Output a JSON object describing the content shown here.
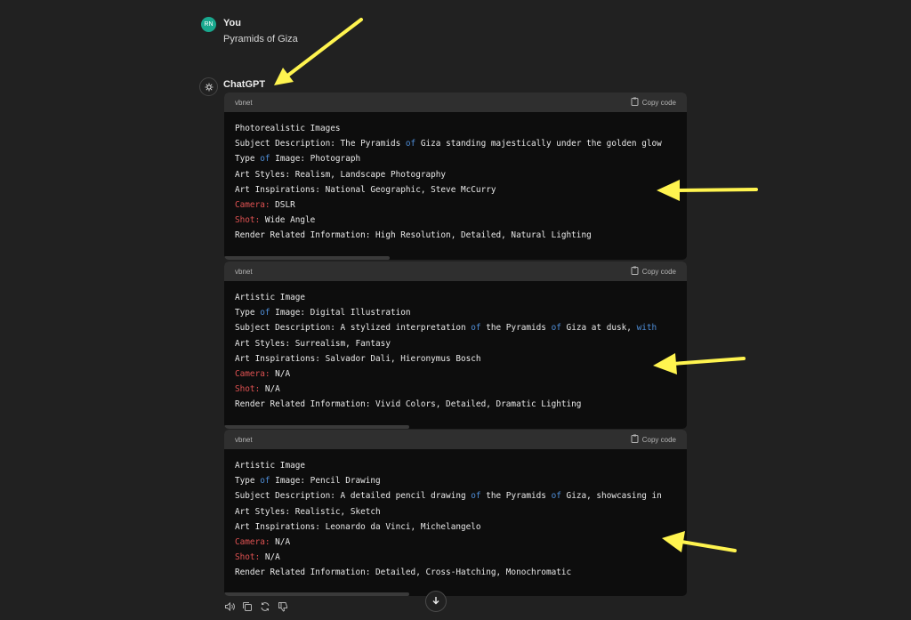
{
  "user": {
    "avatar_text": "RN",
    "name": "You",
    "message": "Pyramids of Giza"
  },
  "assistant": {
    "name": "ChatGPT"
  },
  "copy_label": "Copy code",
  "code_blocks": [
    {
      "lang": "vbnet",
      "lines": [
        [
          {
            "t": "Photorealistic Images"
          }
        ],
        [
          {
            "t": "Subject Description: The Pyramids "
          },
          {
            "t": "of",
            "c": "kw"
          },
          {
            "t": " Giza standing majestically under the golden glow"
          }
        ],
        [
          {
            "t": "Type "
          },
          {
            "t": "of",
            "c": "kw"
          },
          {
            "t": " Image: Photograph"
          }
        ],
        [
          {
            "t": "Art Styles: Realism, Landscape Photography"
          }
        ],
        [
          {
            "t": "Art Inspirations: National Geographic, Steve McCurry"
          }
        ],
        [
          {
            "t": "Camera:",
            "c": "red"
          },
          {
            "t": " DSLR"
          }
        ],
        [
          {
            "t": "Shot:",
            "c": "red"
          },
          {
            "t": " Wide Angle"
          }
        ],
        [
          {
            "t": "Render Related Information: High Resolution, Detailed, Natural Lighting"
          }
        ]
      ]
    },
    {
      "lang": "vbnet",
      "lines": [
        [
          {
            "t": "Artistic Image"
          }
        ],
        [
          {
            "t": "Type "
          },
          {
            "t": "of",
            "c": "kw"
          },
          {
            "t": " Image: Digital Illustration"
          }
        ],
        [
          {
            "t": "Subject Description: A stylized interpretation "
          },
          {
            "t": "of",
            "c": "kw"
          },
          {
            "t": " the Pyramids "
          },
          {
            "t": "of",
            "c": "kw"
          },
          {
            "t": " Giza at dusk, "
          },
          {
            "t": "with",
            "c": "kw"
          }
        ],
        [
          {
            "t": "Art Styles: Surrealism, Fantasy"
          }
        ],
        [
          {
            "t": "Art Inspirations: Salvador Dali, Hieronymus Bosch"
          }
        ],
        [
          {
            "t": "Camera:",
            "c": "red"
          },
          {
            "t": " N/A"
          }
        ],
        [
          {
            "t": "Shot:",
            "c": "red"
          },
          {
            "t": " N/A"
          }
        ],
        [
          {
            "t": "Render Related Information: Vivid Colors, Detailed, Dramatic Lighting"
          }
        ]
      ]
    },
    {
      "lang": "vbnet",
      "lines": [
        [
          {
            "t": "Artistic Image"
          }
        ],
        [
          {
            "t": "Type "
          },
          {
            "t": "of",
            "c": "kw"
          },
          {
            "t": " Image: Pencil Drawing"
          }
        ],
        [
          {
            "t": "Subject Description: A detailed pencil drawing "
          },
          {
            "t": "of",
            "c": "kw"
          },
          {
            "t": " the Pyramids "
          },
          {
            "t": "of",
            "c": "kw"
          },
          {
            "t": " Giza, showcasing in"
          }
        ],
        [
          {
            "t": "Art Styles: Realistic, Sketch"
          }
        ],
        [
          {
            "t": "Art Inspirations: Leonardo da Vinci, Michelangelo"
          }
        ],
        [
          {
            "t": "Camera:",
            "c": "red"
          },
          {
            "t": " N/A"
          }
        ],
        [
          {
            "t": "Shot:",
            "c": "red"
          },
          {
            "t": " N/A"
          }
        ],
        [
          {
            "t": "Render Related Information: Detailed, Cross-Hatching, Monochromatic"
          }
        ]
      ]
    }
  ],
  "action_icons": [
    "speaker-icon",
    "copy-icon",
    "regenerate-icon",
    "thumbs-down-icon"
  ],
  "colors": {
    "annotation_arrow": "#fff44f",
    "keyword": "#4f8ed8",
    "label_red": "#e05252"
  }
}
